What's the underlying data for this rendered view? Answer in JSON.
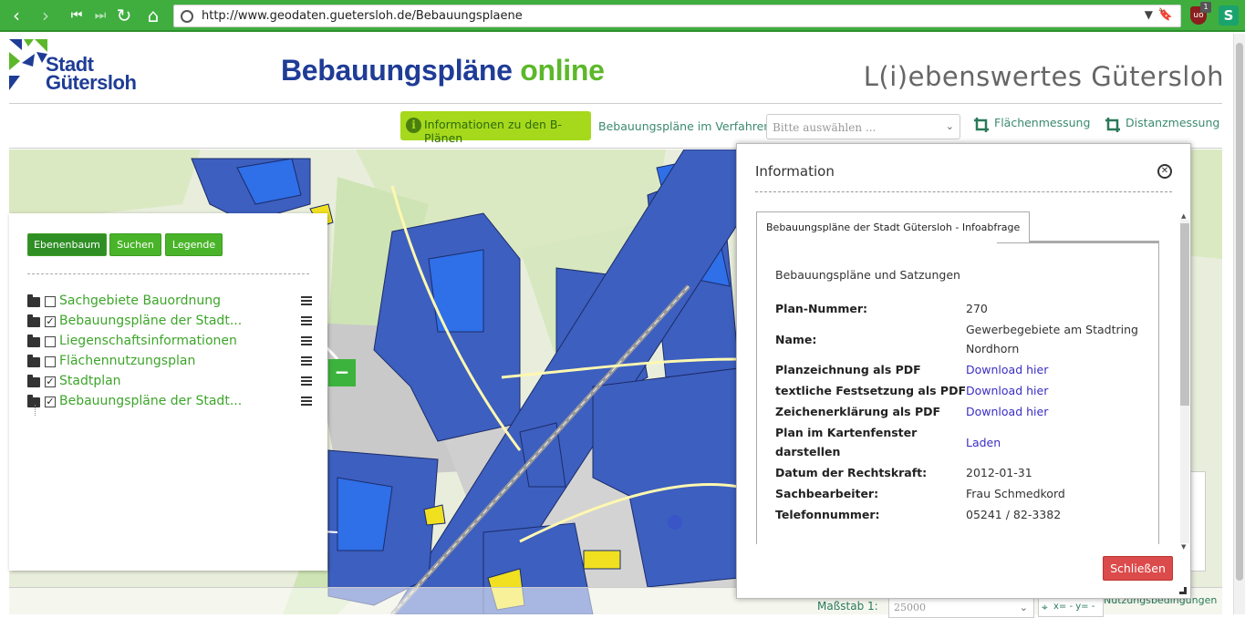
{
  "browser": {
    "url": "http://www.geodaten.guetersloh.de/Bebauungsplaene",
    "ublock_count": "1",
    "ext_s": "S"
  },
  "header": {
    "logo_line1": "Stadt",
    "logo_line2": "Gütersloh",
    "title_part1": "Bebauungspläne",
    "title_part2": "online",
    "tagline": "L(i)ebenswertes Gütersloh"
  },
  "toolbar": {
    "info_button": "Informationen zu den B-Plänen",
    "verfahren_link": "Bebauungspläne im Verfahren",
    "select_placeholder": "Bitte auswählen ...",
    "flaechenmessung": "Flächenmessung",
    "distanzmessung": "Distanzmessung"
  },
  "layer_panel": {
    "tabs": [
      "Ebenenbaum",
      "Suchen",
      "Legende"
    ],
    "layers": [
      {
        "label": "Sachgebiete Bauordnung",
        "checked": false
      },
      {
        "label": "Bebauungspläne der Stadt...",
        "checked": true
      },
      {
        "label": "Liegenschaftsinformationen",
        "checked": false
      },
      {
        "label": "Flächennutzungsplan",
        "checked": false
      },
      {
        "label": "Stadtplan",
        "checked": true
      },
      {
        "label": "Bebauungspläne der Stadt...",
        "checked": true
      }
    ],
    "zoom_out": "−"
  },
  "dialog": {
    "title": "Information",
    "tab": "Bebauungspläne der Stadt Gütersloh - Infoabfrage",
    "subtitle": "Bebauungspläne und Satzungen",
    "rows": [
      {
        "key": "Plan-Nummer:",
        "value": "270",
        "link": false
      },
      {
        "key": "Name:",
        "value": "Gewerbegebiete am Stadtring Nordhorn",
        "link": false
      },
      {
        "key": "Planzeichnung als PDF",
        "value": "Download hier",
        "link": true
      },
      {
        "key": "textliche Festsetzung als PDF",
        "value": "Download hier",
        "link": true
      },
      {
        "key": "Zeichenerklärung als PDF",
        "value": "Download hier",
        "link": true
      },
      {
        "key": "Plan im Kartenfenster darstellen",
        "value": "Laden",
        "link": true
      },
      {
        "key": "Datum der Rechtskraft:",
        "value": "2012-01-31",
        "link": false
      },
      {
        "key": "Sachbearbeiter:",
        "value": "Frau Schmedkord",
        "link": false
      },
      {
        "key": "Telefonnummer:",
        "value": "05241 / 82-3382",
        "link": false
      }
    ],
    "close_button": "Schließen"
  },
  "bottom": {
    "scale_label": "Maßstab 1:",
    "scale_value": "25000",
    "coords": "x= - y= -",
    "nutzung": "Nutzungsbedingungen"
  },
  "colors": {
    "browser_green": "#3fae3f",
    "brand_blue": "#1f3c96",
    "brand_green": "#5cb82a",
    "layer_green": "#3da52a",
    "plan_blue": "#3d5fbf",
    "plan_bright": "#2f6fe8",
    "plan_yellow": "#f0e020",
    "close_red": "#dc4b4b"
  }
}
